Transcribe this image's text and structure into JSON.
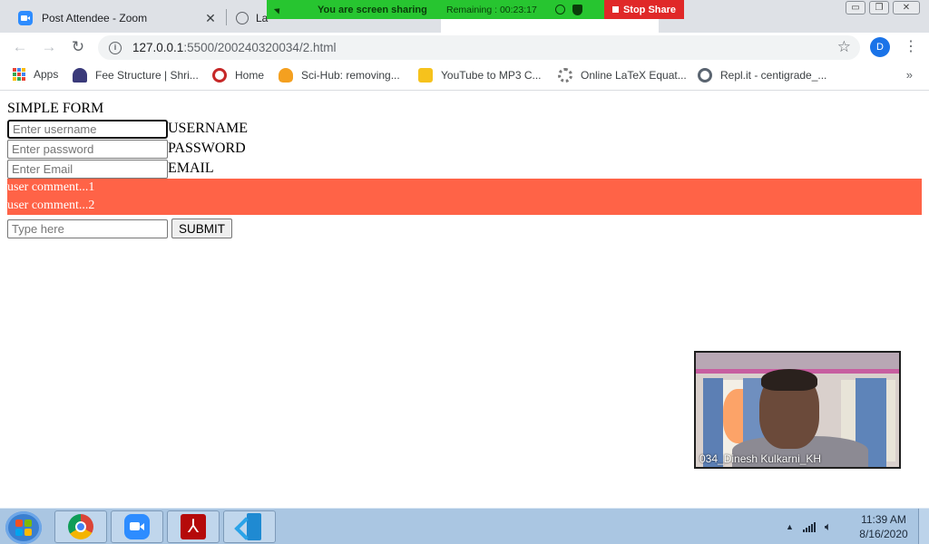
{
  "browser": {
    "tabs": [
      {
        "title": "Post Attendee - Zoom"
      },
      {
        "title": "La"
      }
    ],
    "close_glyph": "✕",
    "window_controls": {
      "minimize": "▭",
      "restore": "❐",
      "close": "✕"
    },
    "address": {
      "host": "127.0.0.1",
      "path": ":5500/200240320034/2.html"
    },
    "profile_initial": "D",
    "bookmarks": [
      {
        "label": "Apps",
        "icon": "apps-grid-icon"
      },
      {
        "label": "Fee Structure | Shri...",
        "icon": "university-icon"
      },
      {
        "label": "Home",
        "icon": "home-site-icon"
      },
      {
        "label": "Sci-Hub: removing...",
        "icon": "scihub-icon"
      },
      {
        "label": "YouTube to MP3 C...",
        "icon": "youtube-mp3-icon"
      },
      {
        "label": "Online LaTeX Equat...",
        "icon": "gear-icon"
      },
      {
        "label": "Repl.it - centigrade_...",
        "icon": "replit-icon"
      }
    ],
    "bookmarks_more": "»"
  },
  "zoom_share": {
    "status": "You are screen sharing",
    "remaining": "Remaining : 00:23:17",
    "stop_label": "Stop Share",
    "green": "#27c530",
    "red": "#e02828"
  },
  "page": {
    "title": "SIMPLE FORM",
    "fields": [
      {
        "placeholder": "Enter username",
        "label": "USERNAME"
      },
      {
        "placeholder": "Enter password",
        "label": "PASSWORD"
      },
      {
        "placeholder": "Enter Email",
        "label": "EMAIL"
      }
    ],
    "comments": [
      "user comment...1",
      "user comment...2"
    ],
    "comment_bg": "#ff6347",
    "comment_input_placeholder": "Type here",
    "submit_label": "SUBMIT"
  },
  "video": {
    "participant_name": "034_Dinesh Kulkarni_KH"
  },
  "taskbar": {
    "apps": [
      "chrome-icon",
      "zoom-icon",
      "acrobat-icon",
      "vscode-icon"
    ],
    "acrobat_glyph": "⅄",
    "time": "11:39 AM",
    "date": "8/16/2020",
    "tray_up": "▲",
    "speaker_glyph": "🔈︎"
  }
}
